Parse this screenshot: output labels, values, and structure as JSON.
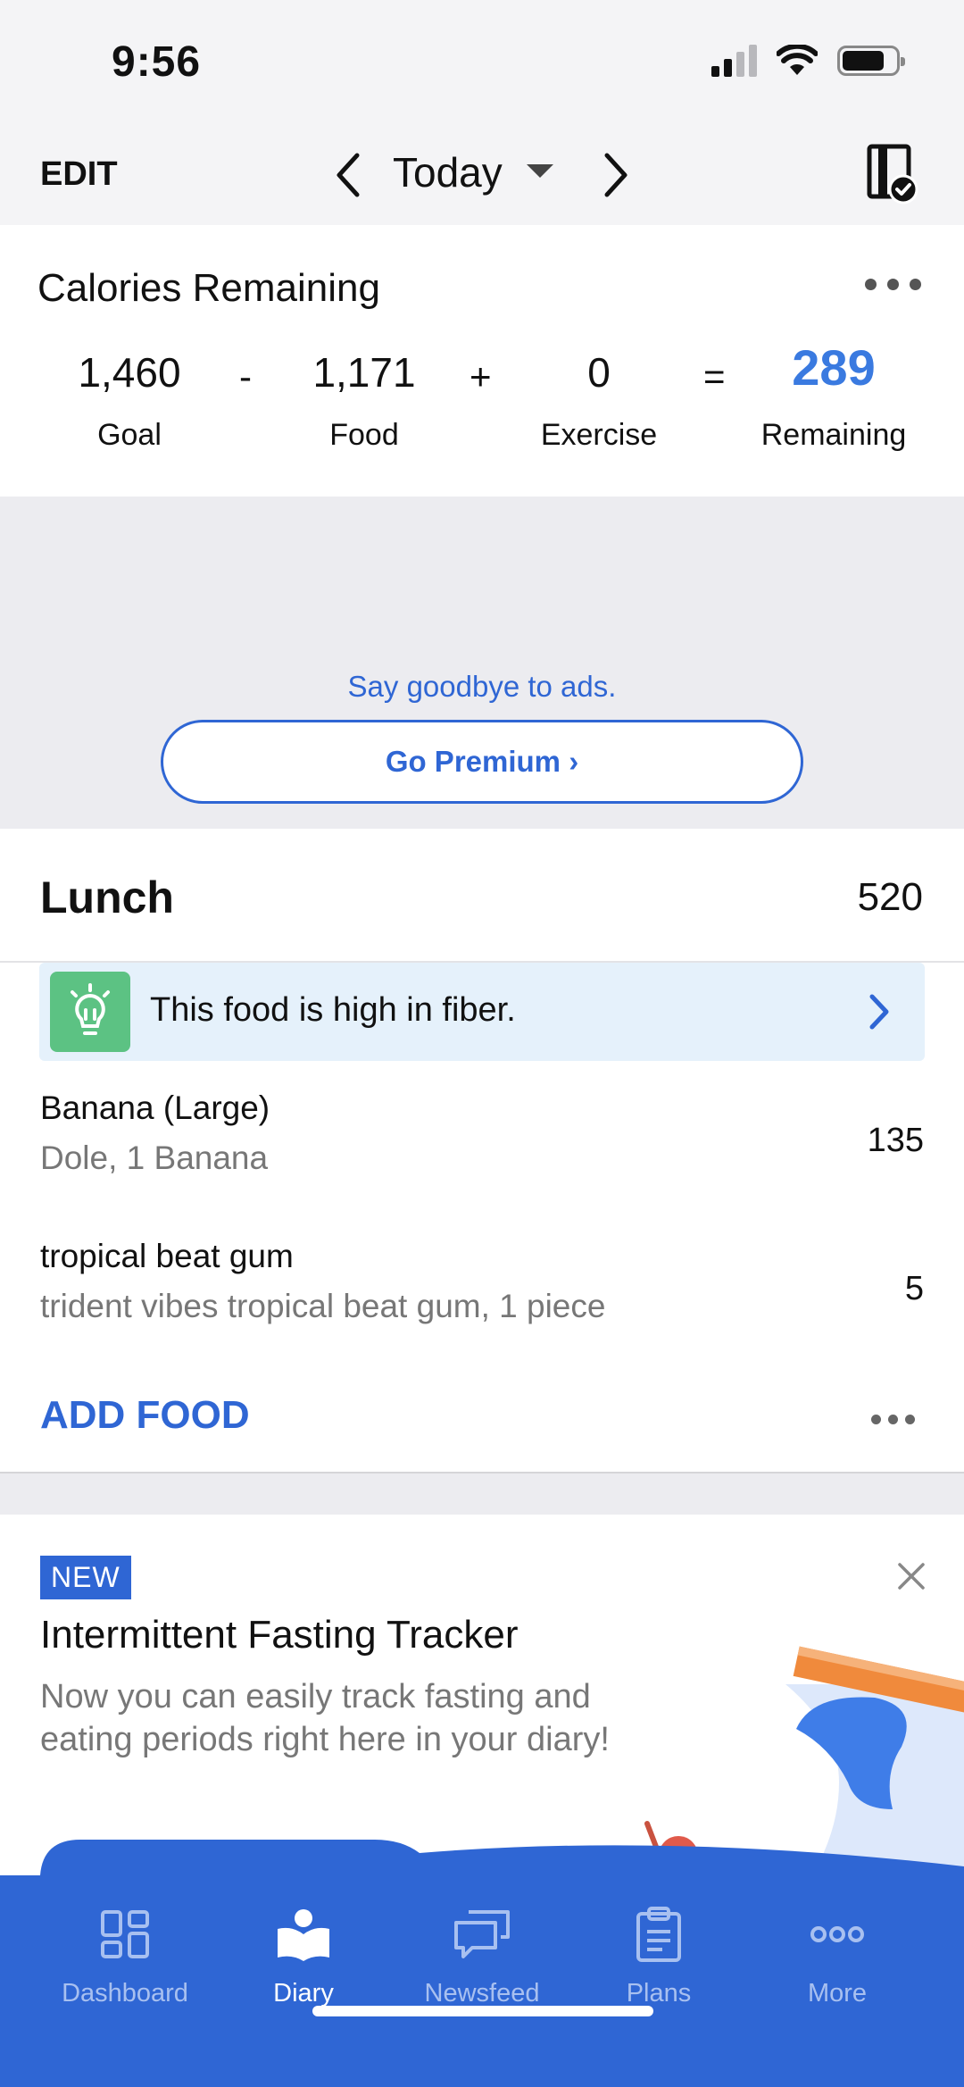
{
  "status_bar": {
    "time": "9:56"
  },
  "header": {
    "edit_label": "EDIT",
    "date_label": "Today"
  },
  "calories": {
    "title": "Calories Remaining",
    "goal_value": "1,460",
    "goal_label": "Goal",
    "op_minus": "-",
    "food_value": "1,171",
    "food_label": "Food",
    "op_plus": "+",
    "exercise_value": "0",
    "exercise_label": "Exercise",
    "op_equals": "=",
    "remaining_value": "289",
    "remaining_label": "Remaining"
  },
  "ad": {
    "text": "Say goodbye to ads.",
    "button_label": "Go Premium ›"
  },
  "lunch": {
    "title": "Lunch",
    "calories": "520",
    "tip": "This food is high in fiber.",
    "items": [
      {
        "name": "Banana (Large)",
        "desc": "Dole, 1 Banana",
        "calories": "135"
      },
      {
        "name": "tropical beat gum",
        "desc": "trident vibes tropical beat gum, 1 piece",
        "calories": "5"
      }
    ],
    "add_food_label": "ADD FOOD"
  },
  "promo": {
    "badge": "NEW",
    "title": "Intermittent Fasting Tracker",
    "text": "Now you can easily track fasting and eating periods right here in your diary!"
  },
  "tabs": [
    {
      "label": "Dashboard",
      "icon": "dashboard-grid-icon"
    },
    {
      "label": "Diary",
      "icon": "diary-book-icon"
    },
    {
      "label": "Newsfeed",
      "icon": "newsfeed-chat-icon"
    },
    {
      "label": "Plans",
      "icon": "plans-clipboard-icon"
    },
    {
      "label": "More",
      "icon": "more-dots-icon"
    }
  ],
  "colors": {
    "accent": "#2f66d4",
    "remaining": "#3a7ae0",
    "tip_bg": "#e5f1fb",
    "tip_icon": "#5cc283",
    "tabbar": "#2f66d4"
  }
}
